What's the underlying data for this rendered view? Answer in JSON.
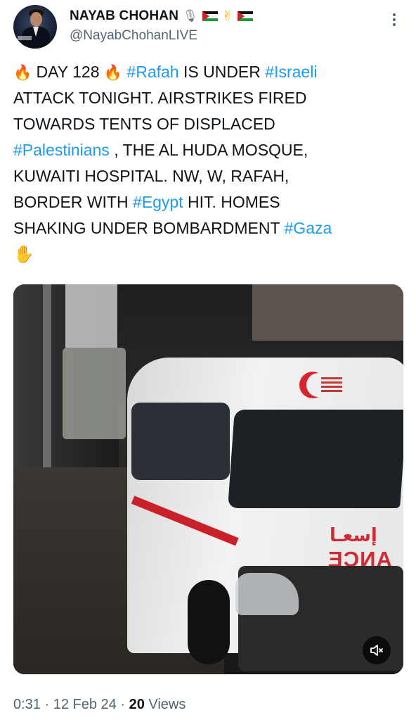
{
  "author": {
    "display_name": "NAYAB CHOHAN",
    "handle": "@NayabChohanLIVE",
    "name_emojis": [
      "microphone-icon",
      "palestine-flag-icon",
      "victory-hand-icon",
      "palestine-flag-icon"
    ]
  },
  "tweet": {
    "lines": [
      [
        {
          "type": "emoji",
          "name": "fire-icon",
          "glyph": "🔥"
        },
        {
          "type": "text",
          "value": " DAY 128 "
        },
        {
          "type": "emoji",
          "name": "fire-icon",
          "glyph": "🔥"
        },
        {
          "type": "text",
          "value": " "
        },
        {
          "type": "hashtag",
          "value": "#Rafah"
        },
        {
          "type": "text",
          "value": " IS UNDER "
        },
        {
          "type": "hashtag",
          "value": "#Israeli"
        }
      ],
      [
        {
          "type": "text",
          "value": "ATTACK TONIGHT. AIRSTRIKES FIRED"
        }
      ],
      [
        {
          "type": "text",
          "value": "TOWARDS TENTS OF DISPLACED"
        }
      ],
      [
        {
          "type": "hashtag",
          "value": "#Palestinians"
        },
        {
          "type": "text",
          "value": " , THE AL HUDA MOSQUE,"
        }
      ],
      [
        {
          "type": "text",
          "value": "KUWAITI HOSPITAL. NW, W, RAFAH,"
        }
      ],
      [
        {
          "type": "text",
          "value": "BORDER WITH "
        },
        {
          "type": "hashtag",
          "value": "#Egypt"
        },
        {
          "type": "text",
          "value": " HIT. HOMES"
        }
      ],
      [
        {
          "type": "text",
          "value": "SHAKING UNDER BOMBARDMENT "
        },
        {
          "type": "hashtag",
          "value": "#Gaza"
        }
      ],
      [
        {
          "type": "emoji",
          "name": "raised-hand-icon",
          "glyph": "✋"
        }
      ]
    ]
  },
  "media": {
    "vehicle_text_arabic": "إسعـا",
    "vehicle_text_mirrored": "ANCE",
    "mute_icon": "mute-icon"
  },
  "meta": {
    "duration": "0:31",
    "separator": " · ",
    "date": "12 Feb 24",
    "views_count": "20",
    "views_label": " Views"
  },
  "colors": {
    "link": "#1d9bf0",
    "text": "#0f1419",
    "secondary": "#536471"
  }
}
